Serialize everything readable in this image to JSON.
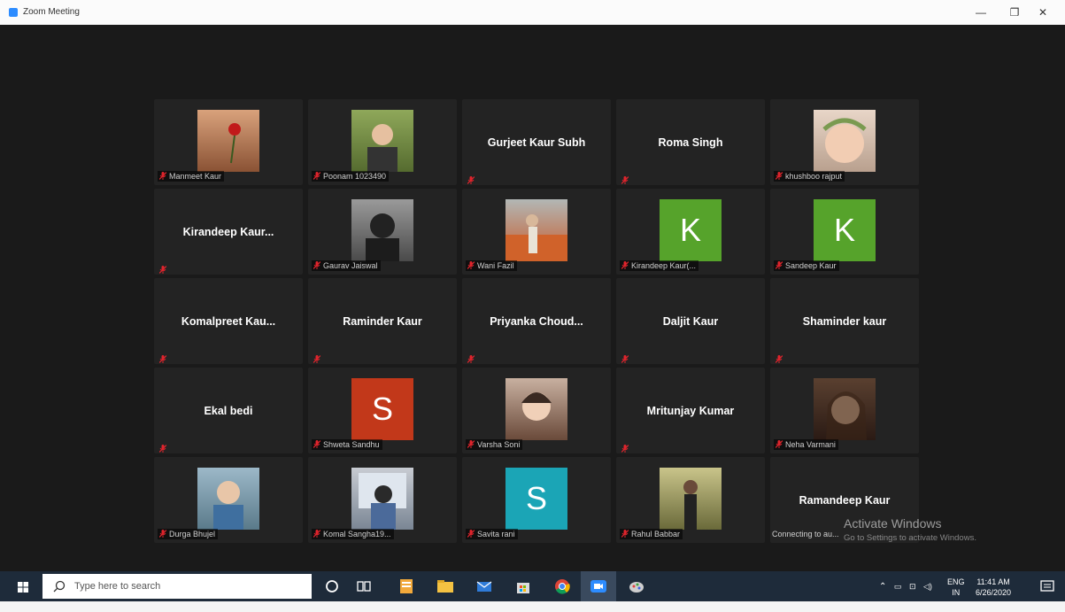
{
  "window": {
    "title": "Zoom Meeting",
    "minimize": "—",
    "maximize": "❐",
    "close": "✕"
  },
  "tiles": [
    {
      "kind": "photo",
      "label": "Manmeet Kaur",
      "photo": "rose"
    },
    {
      "kind": "photo",
      "label": "Poonam 1023490",
      "photo": "person-green"
    },
    {
      "kind": "name",
      "name": "Gurjeet Kaur Subh"
    },
    {
      "kind": "name",
      "name": "Roma Singh"
    },
    {
      "kind": "photo",
      "label": "khushboo rajput",
      "photo": "baby"
    },
    {
      "kind": "name",
      "name": "Kirandeep  Kaur..."
    },
    {
      "kind": "photo",
      "label": "Gaurav Jaiswal",
      "photo": "hoodie"
    },
    {
      "kind": "photo",
      "label": "Wani Fazil",
      "photo": "garden"
    },
    {
      "kind": "avatar",
      "letter": "K",
      "color": "#56a32b",
      "label": "Kirandeep Kaur(..."
    },
    {
      "kind": "avatar",
      "letter": "K",
      "color": "#56a32b",
      "label": "Sandeep Kaur"
    },
    {
      "kind": "name",
      "name": "Komalpreet  Kau..."
    },
    {
      "kind": "name",
      "name": "Raminder Kaur"
    },
    {
      "kind": "name",
      "name": "Priyanka  Choud..."
    },
    {
      "kind": "name",
      "name": "Daljit Kaur"
    },
    {
      "kind": "name",
      "name": "Shaminder kaur"
    },
    {
      "kind": "name",
      "name": "Ekal bedi"
    },
    {
      "kind": "avatar",
      "letter": "S",
      "color": "#c2381a",
      "label": "Shweta Sandhu"
    },
    {
      "kind": "photo",
      "label": "Varsha Soni",
      "photo": "girl"
    },
    {
      "kind": "name",
      "name": "Mritunjay Kumar"
    },
    {
      "kind": "photo",
      "label": "Neha Varmani",
      "photo": "woman"
    },
    {
      "kind": "photo",
      "label": "Durga Bhujel",
      "photo": "boy"
    },
    {
      "kind": "photo",
      "label": "Komal Sangha19...",
      "photo": "window"
    },
    {
      "kind": "avatar",
      "letter": "S",
      "color": "#1ba5b6",
      "label": "Savita rani"
    },
    {
      "kind": "photo",
      "label": "Rahul Babbar",
      "photo": "man-outdoor"
    },
    {
      "kind": "connecting",
      "name": "Ramandeep Kaur",
      "label": "Connecting to au..."
    }
  ],
  "watermark": {
    "line1": "Activate Windows",
    "line2": "Go to Settings to activate Windows."
  },
  "taskbar": {
    "search_placeholder": "Type here to search",
    "lang_top": "ENG",
    "lang_bottom": "IN",
    "time": "11:41 AM",
    "date": "6/26/2020"
  }
}
